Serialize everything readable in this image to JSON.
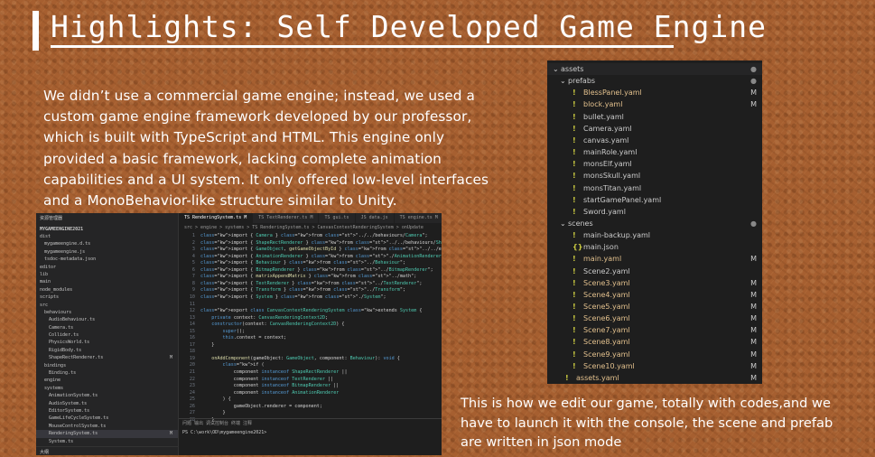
{
  "slide": {
    "title": "Highlights: Self Developed Game Engine",
    "description": "We didn’t use a commercial game engine; instead, we used a custom game engine framework developed by our professor, which is built with TypeScript and HTML. This engine only provided a basic framework, lacking complete animation capabilities and a UI system. It only offered low-level interfaces and a MonoBehavior-like structure similar to Unity.",
    "caption": "This is how we edit our game, totally with codes,and we have to launch it with the console, the scene and prefab are written in json mode"
  },
  "editor": {
    "explorer_label": "资源管理器",
    "project": "MYGAMEENGINE2021",
    "tree": [
      {
        "label": "dist",
        "indent": 0,
        "mod": ""
      },
      {
        "label": "mygameengine.d.ts",
        "indent": 1,
        "mod": ""
      },
      {
        "label": "mygameengine.js",
        "indent": 1,
        "mod": ""
      },
      {
        "label": "tsdoc-metadata.json",
        "indent": 1,
        "mod": ""
      },
      {
        "label": "editor",
        "indent": 0,
        "mod": ""
      },
      {
        "label": "lib",
        "indent": 0,
        "mod": ""
      },
      {
        "label": "main",
        "indent": 0,
        "mod": ""
      },
      {
        "label": "node_modules",
        "indent": 0,
        "mod": ""
      },
      {
        "label": "scripts",
        "indent": 0,
        "mod": ""
      },
      {
        "label": "src",
        "indent": 0,
        "mod": ""
      },
      {
        "label": "behaviours",
        "indent": 1,
        "mod": ""
      },
      {
        "label": "AudioBehaviour.ts",
        "indent": 2,
        "mod": ""
      },
      {
        "label": "Camera.ts",
        "indent": 2,
        "mod": ""
      },
      {
        "label": "Collider.ts",
        "indent": 2,
        "mod": ""
      },
      {
        "label": "PhysicsWorld.ts",
        "indent": 2,
        "mod": ""
      },
      {
        "label": "RigidBody.ts",
        "indent": 2,
        "mod": ""
      },
      {
        "label": "ShapeRectRenderer.ts",
        "indent": 2,
        "mod": "M"
      },
      {
        "label": "bindings",
        "indent": 1,
        "mod": ""
      },
      {
        "label": "Binding.ts",
        "indent": 2,
        "mod": ""
      },
      {
        "label": "engine",
        "indent": 1,
        "mod": ""
      },
      {
        "label": "systems",
        "indent": 1,
        "mod": ""
      },
      {
        "label": "AnimationSystem.ts",
        "indent": 2,
        "mod": ""
      },
      {
        "label": "AudioSystem.ts",
        "indent": 2,
        "mod": ""
      },
      {
        "label": "EditorSystem.ts",
        "indent": 2,
        "mod": ""
      },
      {
        "label": "GameLifeCycleSystem.ts",
        "indent": 2,
        "mod": ""
      },
      {
        "label": "MouseControlSystem.ts",
        "indent": 2,
        "mod": ""
      },
      {
        "label": "RenderingSystem.ts",
        "indent": 2,
        "mod": "M",
        "selected": true
      },
      {
        "label": "System.ts",
        "indent": 2,
        "mod": ""
      }
    ],
    "outline_label": "大纲",
    "tabs": [
      {
        "label": "TS RenderingSystem.ts  M",
        "active": true
      },
      {
        "label": "TS TextRenderer.ts  M",
        "active": false
      },
      {
        "label": "TS gui.ts",
        "active": false
      },
      {
        "label": "JS data.js",
        "active": false
      },
      {
        "label": "TS engine.ts  M",
        "active": false
      },
      {
        "label": "TS index.ts",
        "active": false
      }
    ],
    "breadcrumb": "src > engine > systems > TS RenderingSystem.ts > CanvasContextRenderingSystem > onUpdate",
    "code": [
      "import { Camera } from \"../../behaviours/Camera\";",
      "import { ShapeRectRenderer } from \"../../behaviours/ShapeRectRenderer\";",
      "import { GameObject, getGameObjectById } from \"../../engine\";",
      "import { AnimationRenderer } from \"./AnimationRenderer\";",
      "import { Behaviour } from \"../Behaviour\";",
      "import { BitmapRenderer } from \"../BitmapRenderer\";",
      "import { matrixAppendMatrix } from \"../math\";",
      "import { TextRenderer } from \"../TextRenderer\";",
      "import { Transform } from \"../Transform\";",
      "import { System } from \"./System\";",
      "",
      "export class CanvasContextRenderingSystem extends System {",
      "    private context: CanvasRenderingContext2D;",
      "    constructor(context: CanvasRenderingContext2D) {",
      "        super();",
      "        this.context = context;",
      "    }",
      "",
      "    onAddComponent(gameObject: GameObject, component: Behaviour): void {",
      "        if (",
      "            component instanceof ShapeRectRenderer ||",
      "            component instanceof TextRenderer ||",
      "            component instanceof BitmapRenderer ||",
      "            component instanceof AnimationRenderer",
      "        ) {",
      "            gameObject.renderer = component;",
      "        }",
      "    }"
    ],
    "terminal_tabs": "问题   输出   调试控制台   终端   注释",
    "terminal_line": "PS C:\\work\\OD\\mygameengine2021>"
  },
  "assets_panel": {
    "rows": [
      {
        "label": "assets",
        "kind": "folder-open",
        "indent": 0,
        "badge": "dot",
        "modified": false,
        "head": true
      },
      {
        "label": "prefabs",
        "kind": "folder-open",
        "indent": 1,
        "badge": "dot",
        "modified": false
      },
      {
        "label": "BlessPanel.yaml",
        "kind": "yaml",
        "indent": 2,
        "badge": "M",
        "modified": true
      },
      {
        "label": "block.yaml",
        "kind": "yaml",
        "indent": 2,
        "badge": "M",
        "modified": true
      },
      {
        "label": "bullet.yaml",
        "kind": "yaml",
        "indent": 2,
        "badge": "",
        "modified": false
      },
      {
        "label": "Camera.yaml",
        "kind": "yaml",
        "indent": 2,
        "badge": "",
        "modified": false
      },
      {
        "label": "canvas.yaml",
        "kind": "yaml",
        "indent": 2,
        "badge": "",
        "modified": false
      },
      {
        "label": "mainRole.yaml",
        "kind": "yaml",
        "indent": 2,
        "badge": "",
        "modified": false
      },
      {
        "label": "monsElf.yaml",
        "kind": "yaml",
        "indent": 2,
        "badge": "",
        "modified": false
      },
      {
        "label": "monsSkull.yaml",
        "kind": "yaml",
        "indent": 2,
        "badge": "",
        "modified": false
      },
      {
        "label": "monsTitan.yaml",
        "kind": "yaml",
        "indent": 2,
        "badge": "",
        "modified": false
      },
      {
        "label": "startGamePanel.yaml",
        "kind": "yaml",
        "indent": 2,
        "badge": "",
        "modified": false
      },
      {
        "label": "Sword.yaml",
        "kind": "yaml",
        "indent": 2,
        "badge": "",
        "modified": false
      },
      {
        "label": "scenes",
        "kind": "folder-open",
        "indent": 1,
        "badge": "dot",
        "modified": false
      },
      {
        "label": "main-backup.yaml",
        "kind": "yaml",
        "indent": 2,
        "badge": "",
        "modified": false
      },
      {
        "label": "main.json",
        "kind": "json",
        "indent": 2,
        "badge": "",
        "modified": false
      },
      {
        "label": "main.yaml",
        "kind": "yaml",
        "indent": 2,
        "badge": "M",
        "modified": true
      },
      {
        "label": "Scene2.yaml",
        "kind": "yaml",
        "indent": 2,
        "badge": "",
        "modified": false
      },
      {
        "label": "Scene3.yaml",
        "kind": "yaml",
        "indent": 2,
        "badge": "M",
        "modified": true
      },
      {
        "label": "Scene4.yaml",
        "kind": "yaml",
        "indent": 2,
        "badge": "M",
        "modified": true
      },
      {
        "label": "Scene5.yaml",
        "kind": "yaml",
        "indent": 2,
        "badge": "M",
        "modified": true
      },
      {
        "label": "Scene6.yaml",
        "kind": "yaml",
        "indent": 2,
        "badge": "M",
        "modified": true
      },
      {
        "label": "Scene7.yaml",
        "kind": "yaml",
        "indent": 2,
        "badge": "M",
        "modified": true
      },
      {
        "label": "Scene8.yaml",
        "kind": "yaml",
        "indent": 2,
        "badge": "M",
        "modified": true
      },
      {
        "label": "Scene9.yaml",
        "kind": "yaml",
        "indent": 2,
        "badge": "M",
        "modified": true
      },
      {
        "label": "Scene10.yaml",
        "kind": "yaml",
        "indent": 2,
        "badge": "M",
        "modified": true
      },
      {
        "label": "assets.yaml",
        "kind": "yaml",
        "indent": 1,
        "badge": "M",
        "modified": true
      }
    ]
  },
  "colors": {
    "background": "#a65f30",
    "text": "#ffffff",
    "modified": "#e2c08d",
    "yaml_icon": "#cbcb41"
  }
}
